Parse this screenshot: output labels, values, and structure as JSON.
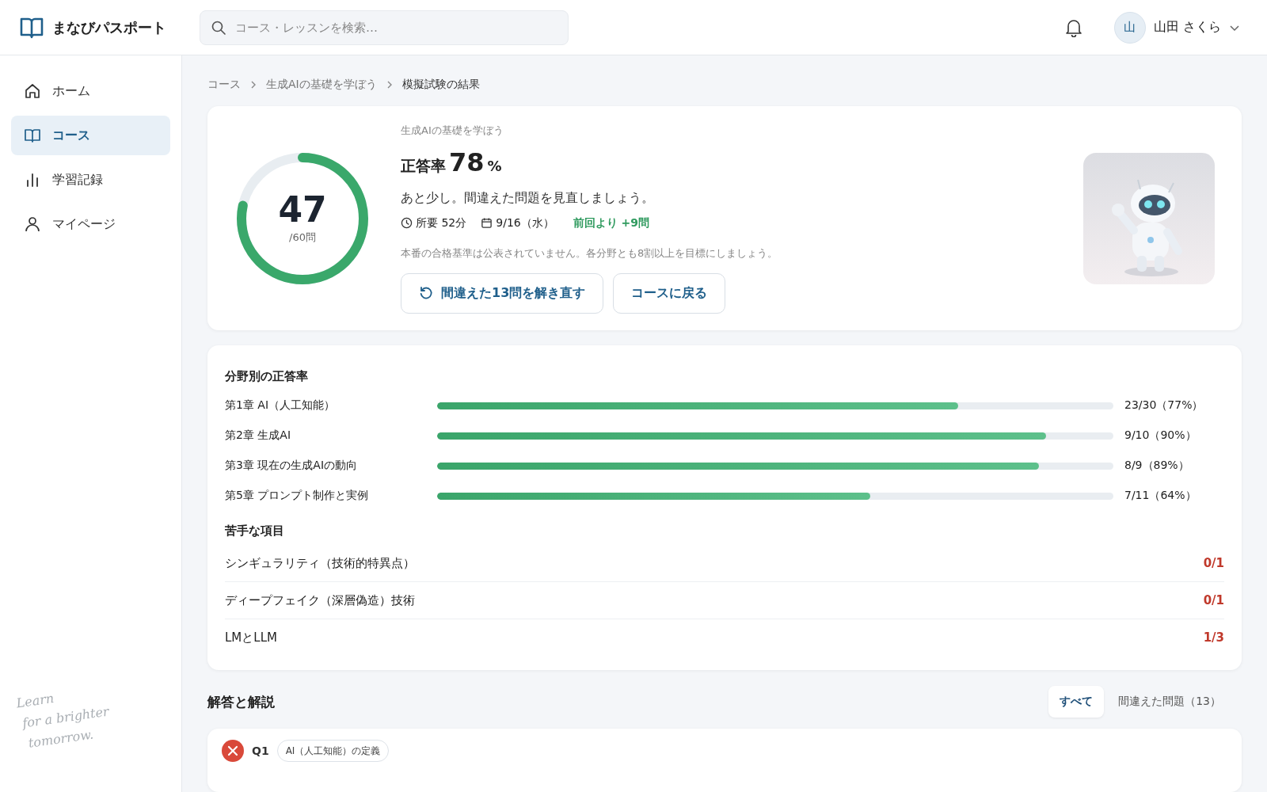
{
  "header": {
    "logo": "まなびパスポート",
    "search": {
      "placeholder": "コース・レッスンを検索…"
    },
    "user": {
      "avatar": "山",
      "name": "山田 さくら"
    }
  },
  "sidebar": {
    "items": [
      {
        "label": "ホーム",
        "selected": false
      },
      {
        "label": "コース",
        "selected": true
      },
      {
        "label": "学習記録",
        "selected": false
      },
      {
        "label": "マイページ",
        "selected": false
      }
    ],
    "tagline": [
      "Learn",
      "for a brighter",
      "tomorrow."
    ]
  },
  "breadcrumb": [
    "コース",
    "生成AIの基礎を学ぼう",
    "模擬試験の結果"
  ],
  "result": {
    "score": "47",
    "total": "/60問",
    "level": 0.783,
    "course": "生成AIの基礎を学ぼう",
    "rate_label": "正答率",
    "rate": "78",
    "rate_unit": "%",
    "message": "あと少し。間違えた問題を見直しましょう。",
    "duration": "所要 52分",
    "date": "9/16（水）",
    "delta": "前回より +9問",
    "note": "本番の合格基準は公表されていません。各分野とも8割以上を目標にしましょう。",
    "buttons": [
      {
        "label": "間違えた13問を解き直す",
        "kind": "retry"
      },
      {
        "label": "コースに戻る",
        "kind": "plain"
      }
    ]
  },
  "by_field": {
    "title": "分野別の正答率",
    "rows": [
      {
        "label": "第1章 AI（人工知能）",
        "level": 0.77,
        "reading": "23/30（77%）"
      },
      {
        "label": "第2章 生成AI",
        "level": 0.9,
        "reading": "9/10（90%）"
      },
      {
        "label": "第3章 現在の生成AIの動向",
        "level": 0.89,
        "reading": "8/9（89%）"
      },
      {
        "label": "第5章 プロンプト制作と実例",
        "level": 0.64,
        "reading": "7/11（64%）"
      }
    ]
  },
  "weak": {
    "title": "苦手な項目",
    "rows": [
      {
        "label": "シンギュラリティ（技術的特異点）",
        "score": "0/1"
      },
      {
        "label": "ディープフェイク（深層偽造）技術",
        "score": "0/1"
      },
      {
        "label": "LMとLLM",
        "score": "1/3"
      }
    ]
  },
  "answers": {
    "title": "解答と解説",
    "tabs": [
      {
        "label": "すべて",
        "selected": true
      },
      {
        "label": "間違えた問題（13）",
        "selected": false
      }
    ],
    "questions": [
      {
        "correct": false,
        "number": "Q1",
        "tag": "AI（人工知能）の定義"
      }
    ]
  }
}
